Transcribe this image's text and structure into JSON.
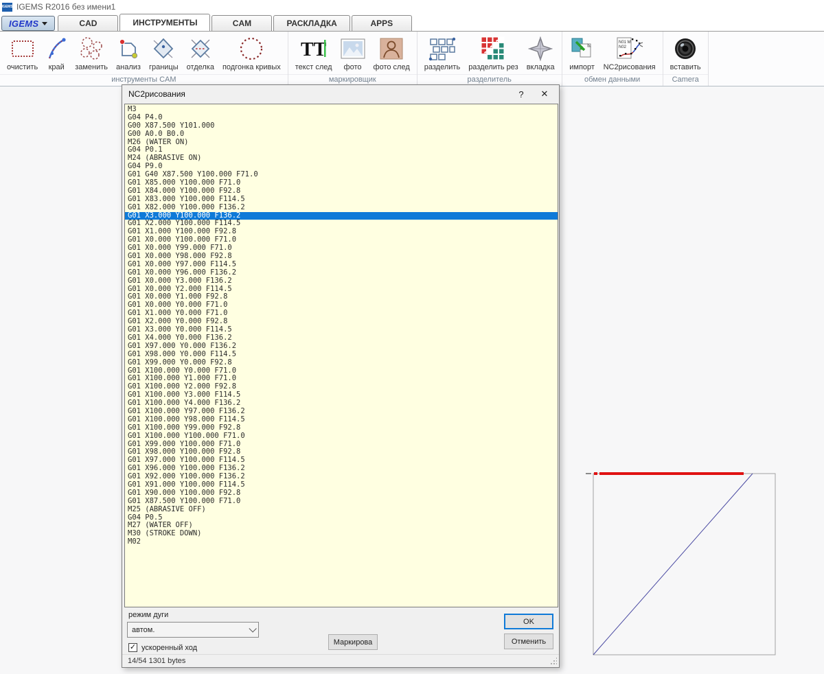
{
  "window": {
    "title": "IGEMS R2016  без имени1",
    "icon_label": "IGEMS"
  },
  "menu_button": {
    "label": "IGEMS"
  },
  "tabs": [
    {
      "label": "CAD",
      "active": false
    },
    {
      "label": "ИНСТРУМЕНТЫ",
      "active": true
    },
    {
      "label": "CAM",
      "active": false
    },
    {
      "label": "РАСКЛАДКА",
      "active": false
    },
    {
      "label": "APPS",
      "active": false
    }
  ],
  "ribbon": {
    "groups": [
      {
        "label": "инструменты CAM",
        "tools": [
          {
            "label": "очистить",
            "icon": "clear-contours-icon"
          },
          {
            "label": "край",
            "icon": "edge-icon"
          },
          {
            "label": "заменить",
            "icon": "replace-icon"
          },
          {
            "label": "анализ",
            "icon": "analyze-icon"
          },
          {
            "label": "границы",
            "icon": "boundaries-icon"
          },
          {
            "label": "отделка",
            "icon": "finishing-icon"
          },
          {
            "label": "подгонка кривых",
            "icon": "curve-fit-icon"
          }
        ]
      },
      {
        "label": "маркировщик",
        "tools": [
          {
            "label": "текст след",
            "icon": "text-trace-icon"
          },
          {
            "label": "фото",
            "icon": "photo-icon"
          },
          {
            "label": "фото след",
            "icon": "photo-trace-icon"
          }
        ]
      },
      {
        "label": "разделитель",
        "tools": [
          {
            "label": "разделить",
            "icon": "divide-icon"
          },
          {
            "label": "разделить рез",
            "icon": "divide-cut-icon"
          },
          {
            "label": "вкладка",
            "icon": "tab-insert-icon"
          }
        ]
      },
      {
        "label": "обмен данными",
        "tools": [
          {
            "label": "импорт",
            "icon": "import-icon"
          },
          {
            "label": "NC2рисования",
            "icon": "nc2drawing-icon"
          }
        ]
      },
      {
        "label": "Camera",
        "tools": [
          {
            "label": "вставить",
            "icon": "camera-icon"
          }
        ]
      }
    ]
  },
  "dialog": {
    "title": "NC2рисования",
    "help_button": "?",
    "close_button": "✕",
    "selected_line_index": 13,
    "nc_lines": [
      "M3",
      "G04 P4.0",
      "G00 X87.500 Y101.000",
      "G00 A0.0 B0.0",
      "M26 (WATER ON)",
      "G04 P0.1",
      "M24 (ABRASIVE ON)",
      "G04 P9.0",
      "G01 G40 X87.500 Y100.000 F71.0",
      "G01 X85.000 Y100.000 F71.0",
      "G01 X84.000 Y100.000 F92.8",
      "G01 X83.000 Y100.000 F114.5",
      "G01 X82.000 Y100.000 F136.2",
      "G01 X3.000 Y100.000 F136.2",
      "G01 X2.000 Y100.000 F114.5",
      "G01 X1.000 Y100.000 F92.8",
      "G01 X0.000 Y100.000 F71.0",
      "G01 X0.000 Y99.000 F71.0",
      "G01 X0.000 Y98.000 F92.8",
      "G01 X0.000 Y97.000 F114.5",
      "G01 X0.000 Y96.000 F136.2",
      "G01 X0.000 Y3.000 F136.2",
      "G01 X0.000 Y2.000 F114.5",
      "G01 X0.000 Y1.000 F92.8",
      "G01 X0.000 Y0.000 F71.0",
      "G01 X1.000 Y0.000 F71.0",
      "G01 X2.000 Y0.000 F92.8",
      "G01 X3.000 Y0.000 F114.5",
      "G01 X4.000 Y0.000 F136.2",
      "G01 X97.000 Y0.000 F136.2",
      "G01 X98.000 Y0.000 F114.5",
      "G01 X99.000 Y0.000 F92.8",
      "G01 X100.000 Y0.000 F71.0",
      "G01 X100.000 Y1.000 F71.0",
      "G01 X100.000 Y2.000 F92.8",
      "G01 X100.000 Y3.000 F114.5",
      "G01 X100.000 Y4.000 F136.2",
      "G01 X100.000 Y97.000 F136.2",
      "G01 X100.000 Y98.000 F114.5",
      "G01 X100.000 Y99.000 F92.8",
      "G01 X100.000 Y100.000 F71.0",
      "G01 X99.000 Y100.000 F71.0",
      "G01 X98.000 Y100.000 F92.8",
      "G01 X97.000 Y100.000 F114.5",
      "G01 X96.000 Y100.000 F136.2",
      "G01 X92.000 Y100.000 F136.2",
      "G01 X91.000 Y100.000 F114.5",
      "G01 X90.000 Y100.000 F92.8",
      "G01 X87.500 Y100.000 F71.0",
      "M25 (ABRASIVE OFF)",
      "G04 P0.5",
      "M27 (WATER OFF)",
      "M30 (STROKE DOWN)",
      "M02"
    ],
    "arc_mode_label": "режим дуги",
    "arc_mode_value": "автом.",
    "rapid_checkbox": {
      "label": "ускоренный ход",
      "checked": true,
      "check_glyph": "✓"
    },
    "marking_button": "Маркирова",
    "ok_button": "OK",
    "cancel_button": "Отменить",
    "status": "14/54   1301 bytes"
  },
  "preview": {
    "contour_color": "#a2a2a2",
    "rapid_color": "#4a4aa2",
    "selected_color": "#e01212",
    "selection_highlight_color": "#0f7ad8",
    "text_area_color": "#ffffe1"
  }
}
